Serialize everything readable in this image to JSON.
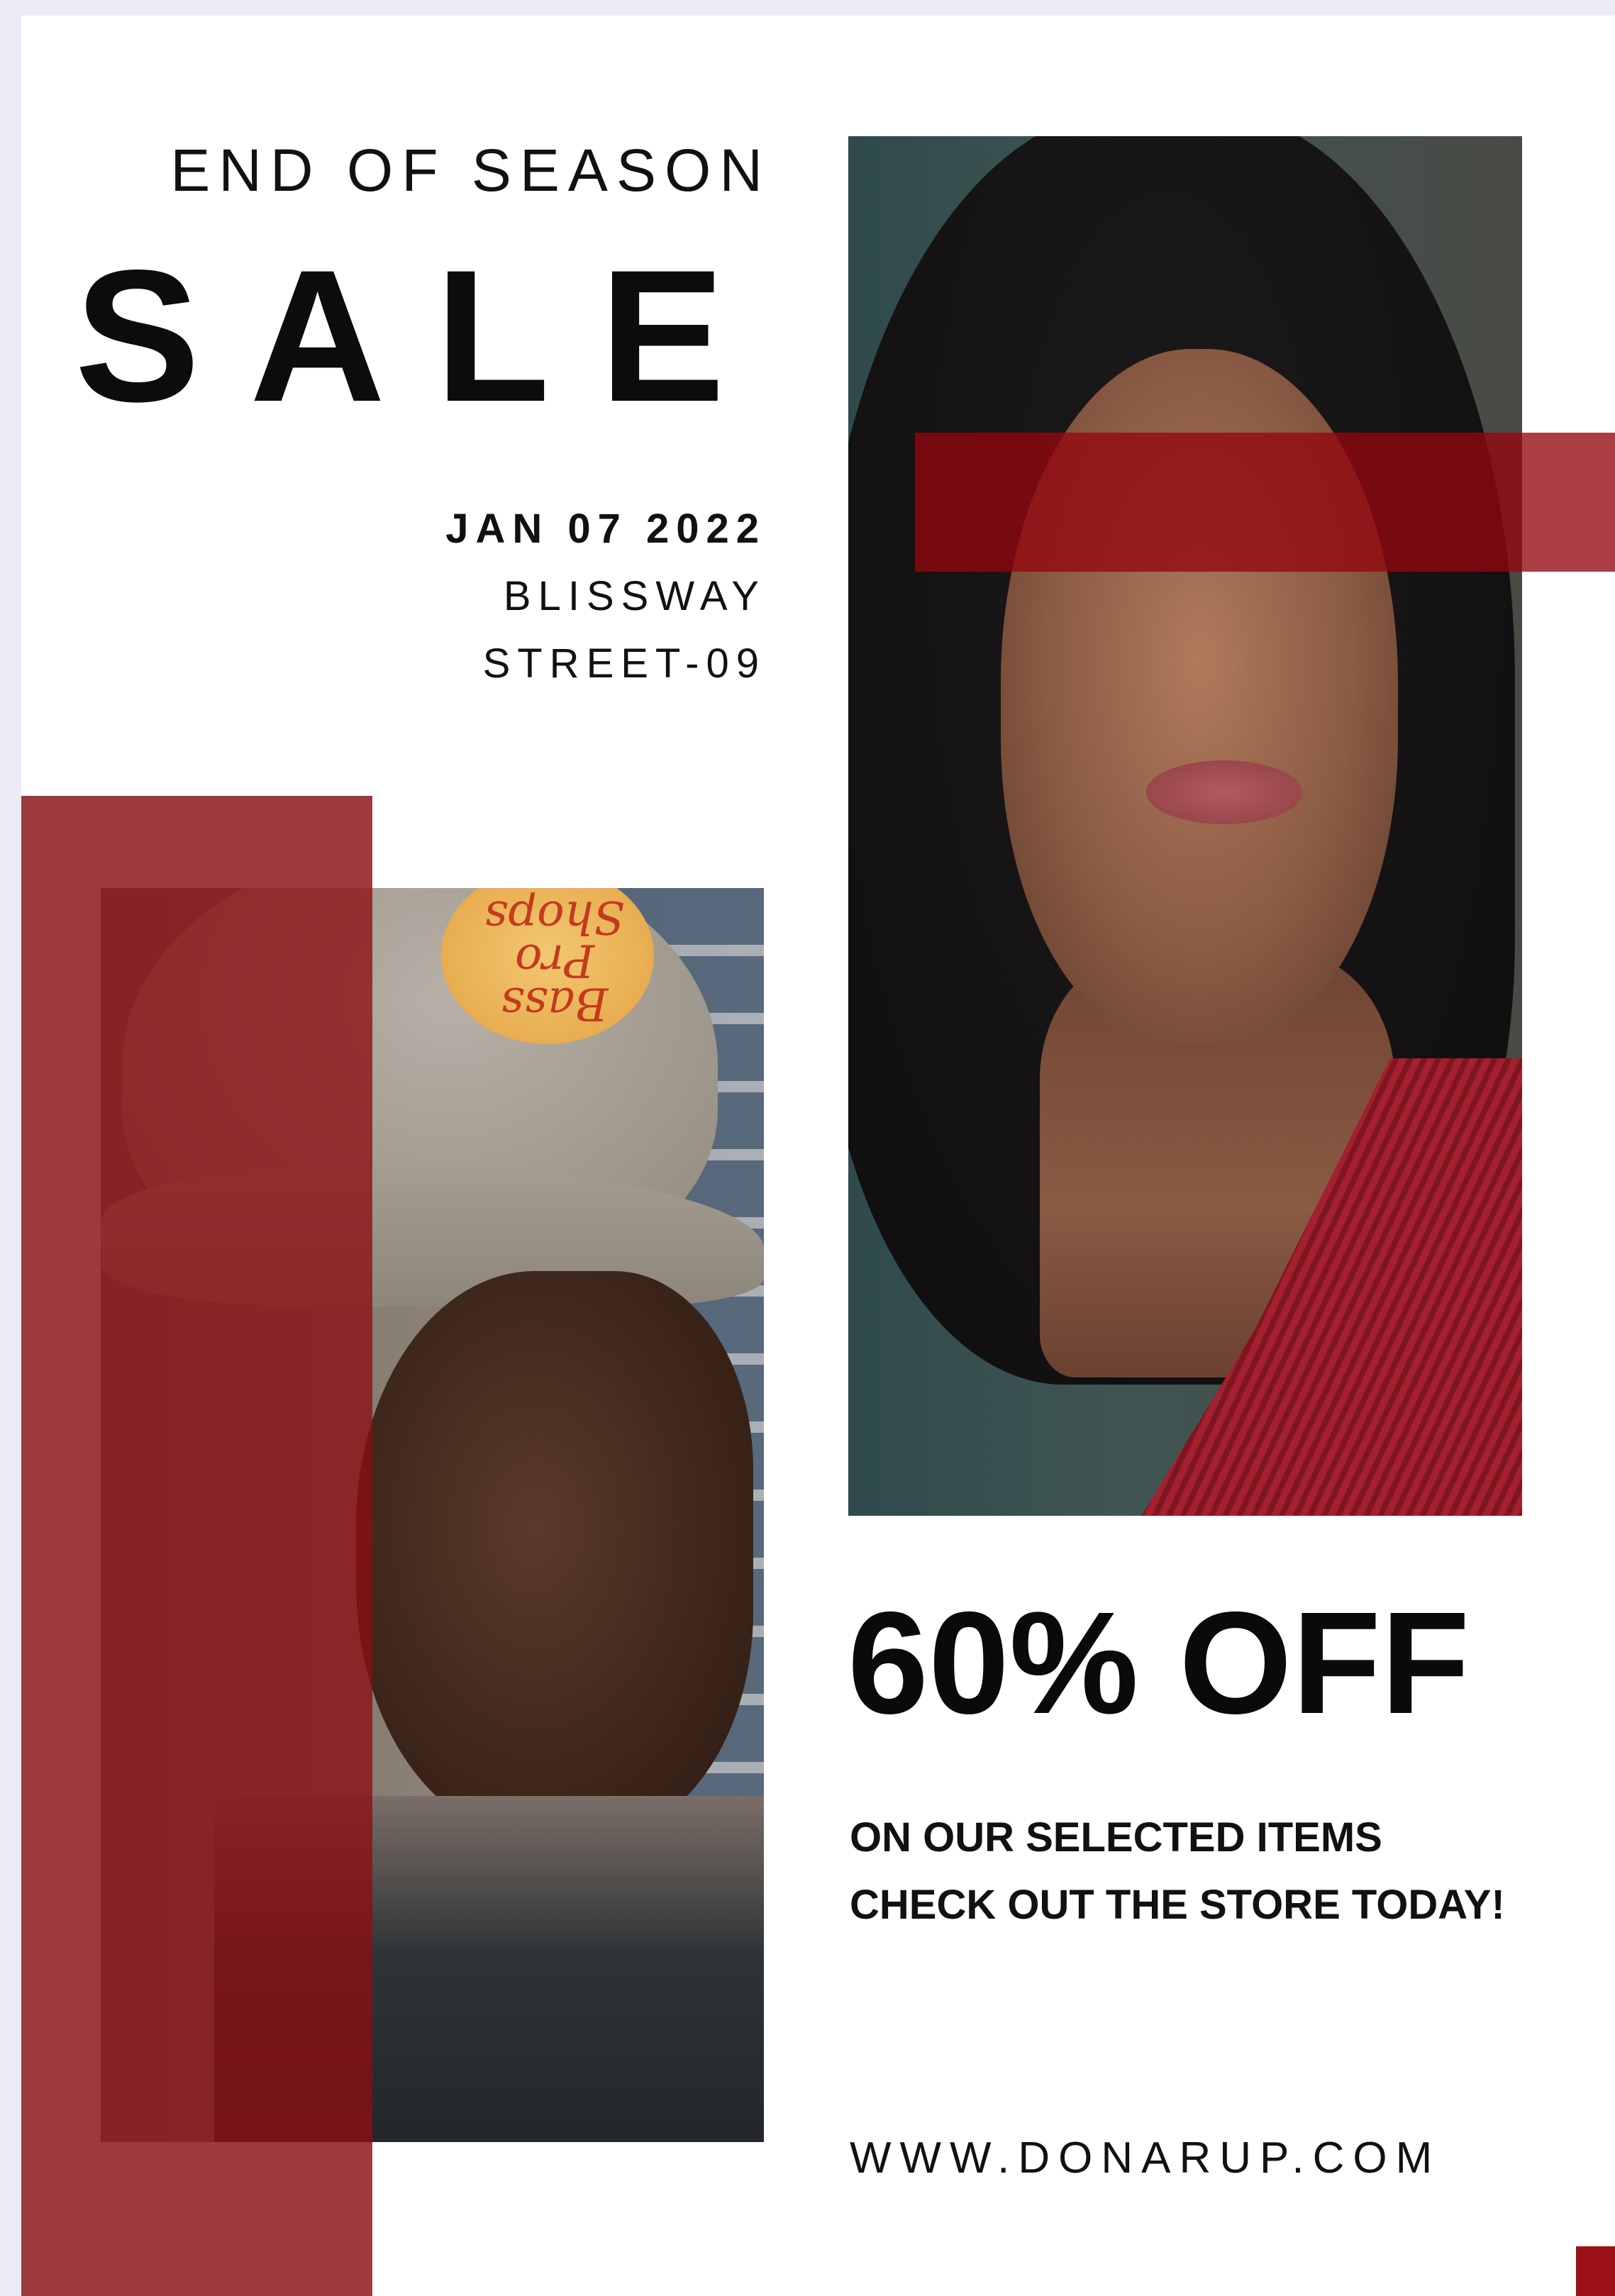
{
  "poster": {
    "eyebrow": "END OF SEASON",
    "headline": "SALE",
    "date": "JAN 07 2022",
    "address_line1": "BLISSWAY",
    "address_line2": "STREET-09",
    "offer": "60% OFF",
    "subtext_line1": "ON OUR SELECTED ITEMS",
    "subtext_line2": "CHECK OUT THE STORE TODAY!",
    "website": "WWW.DONARUP.COM",
    "cap_patch_text": "Bass Pro Shops"
  },
  "colors": {
    "accent_red": "#9c3a40",
    "overlay_red": "#930610",
    "text": "#111111",
    "background": "#ffffff"
  }
}
